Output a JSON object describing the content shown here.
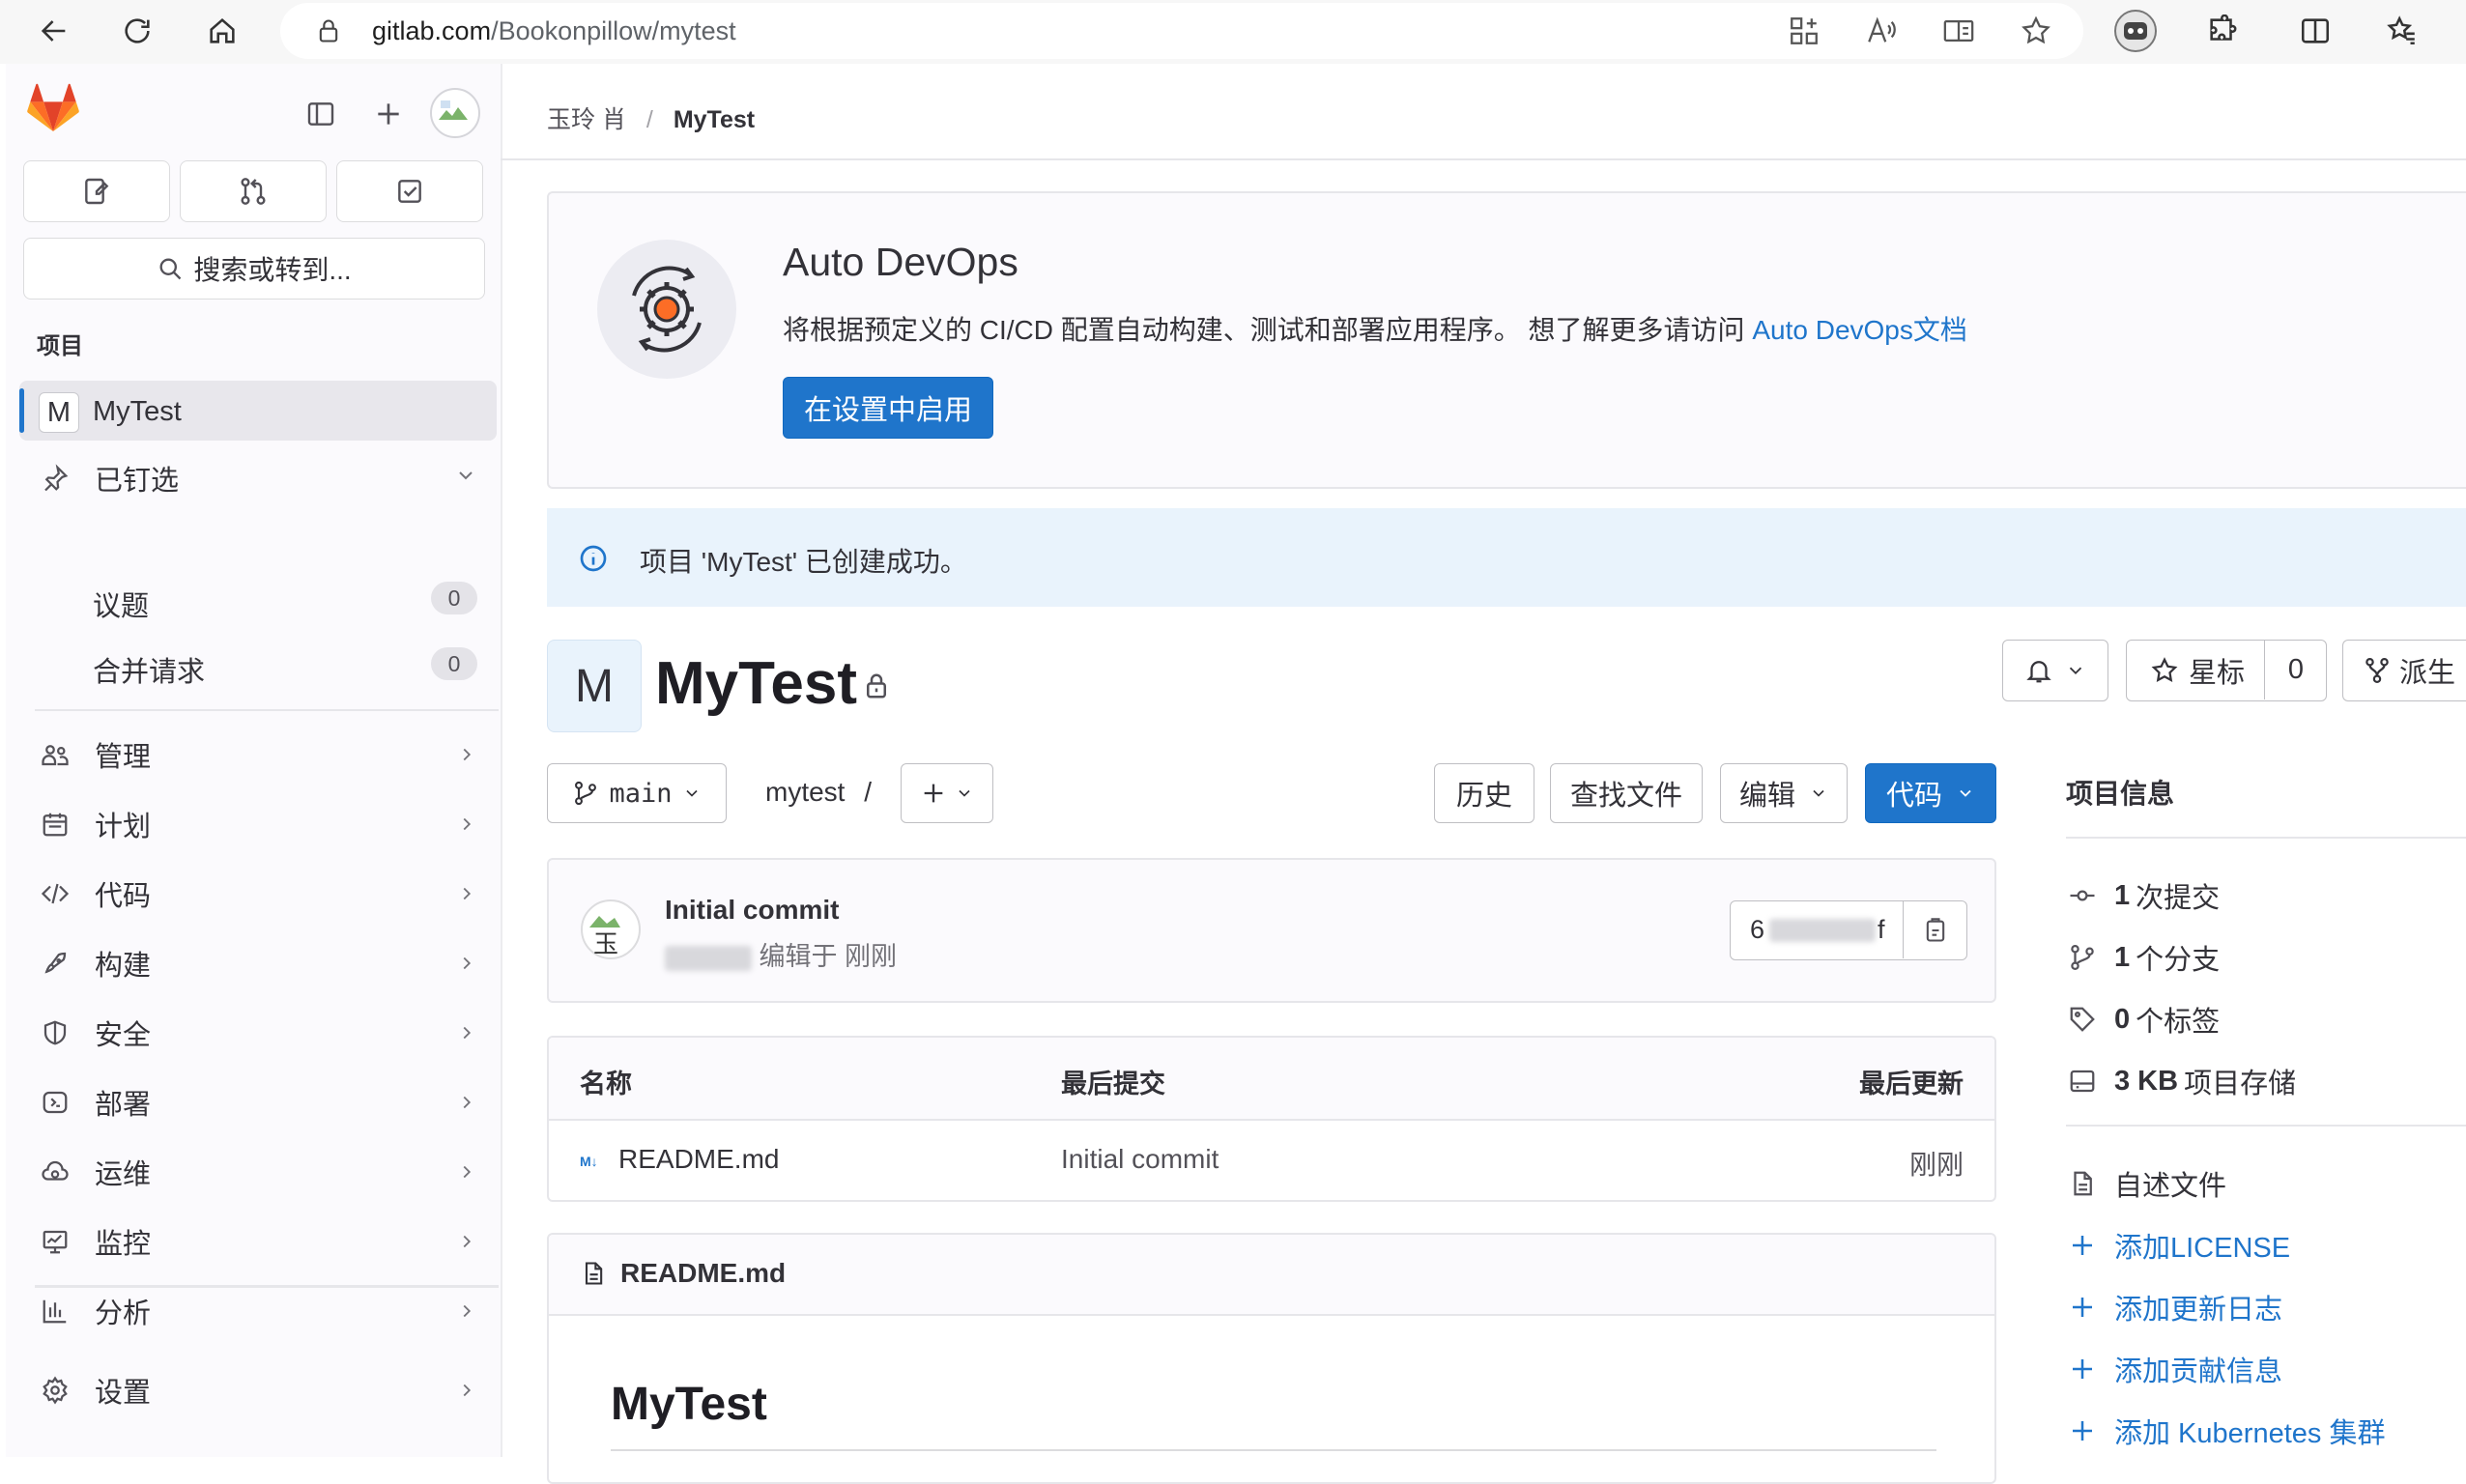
{
  "browser": {
    "url_host": "gitlab.com",
    "url_path": "/Bookonpillow/mytest"
  },
  "sidebar": {
    "search_label": "搜索或转到...",
    "section_title": "项目",
    "project_initial": "M",
    "project_name": "MyTest",
    "pinned": {
      "label": "已钉选",
      "issues_label": "议题",
      "issues_count": "0",
      "mr_label": "合并请求",
      "mr_count": "0"
    },
    "items": [
      {
        "label": "管理",
        "icon": "users-icon"
      },
      {
        "label": "计划",
        "icon": "calendar-icon"
      },
      {
        "label": "代码",
        "icon": "code-icon"
      },
      {
        "label": "构建",
        "icon": "rocket-icon"
      },
      {
        "label": "安全",
        "icon": "shield-icon"
      },
      {
        "label": "部署",
        "icon": "deployments-icon"
      },
      {
        "label": "运维",
        "icon": "cloud-gear-icon"
      },
      {
        "label": "监控",
        "icon": "monitor-icon"
      },
      {
        "label": "分析",
        "icon": "chart-icon"
      },
      {
        "label": "设置",
        "icon": "gear-icon"
      }
    ]
  },
  "breadcrumb": {
    "owner": "玉玲 肖",
    "separator": "/",
    "project": "MyTest"
  },
  "devops": {
    "title": "Auto DevOps",
    "desc": "将根据预定义的 CI/CD 配置自动构建、测试和部署应用程序。 想了解更多请访问 ",
    "link": "Auto DevOps文档",
    "button": "在设置中启用"
  },
  "alert": {
    "text": "项目 'MyTest' 已创建成功。"
  },
  "project": {
    "initial": "M",
    "title": "MyTest",
    "star_label": "星标",
    "star_count": "0",
    "fork_label": "派生"
  },
  "repo": {
    "branch": "main",
    "path": "mytest",
    "path_sep": "/",
    "history": "历史",
    "find_file": "查找文件",
    "edit": "编辑",
    "code": "代码"
  },
  "commit": {
    "title": "Initial commit",
    "meta": "编辑于 刚刚",
    "sha_start": "6",
    "sha_end": "f"
  },
  "table": {
    "headers": {
      "name": "名称",
      "last_commit": "最后提交",
      "last_update": "最后更新"
    },
    "rows": [
      {
        "name": "README.md",
        "commit": "Initial commit",
        "updated": "刚刚"
      }
    ]
  },
  "readme": {
    "filename": "README.md",
    "h1": "MyTest"
  },
  "project_info": {
    "title": "项目信息",
    "commits": {
      "n": "1",
      "label": "次提交"
    },
    "branches": {
      "n": "1",
      "label": "个分支"
    },
    "tags": {
      "n": "0",
      "label": "个标签"
    },
    "storage": {
      "n": "3 KB",
      "label": "项目存储"
    },
    "readme_label": "自述文件",
    "links": [
      "添加LICENSE",
      "添加更新日志",
      "添加贡献信息",
      "添加 Kubernetes 集群"
    ]
  },
  "colors": {
    "accent": "#1f75cb",
    "sidebar_bg": "#fbfafd",
    "info_bg": "#e9f3fc"
  }
}
